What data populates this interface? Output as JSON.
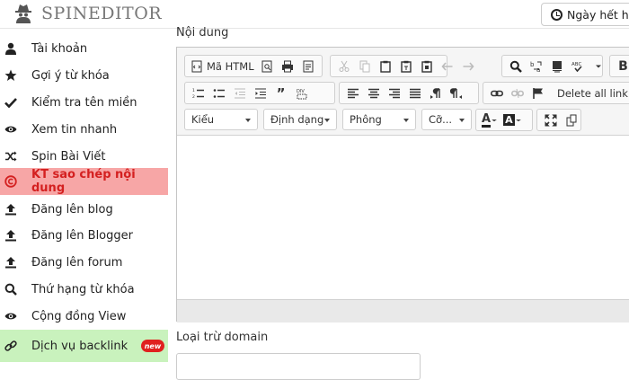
{
  "app": {
    "name": "SPINEDITOR",
    "expiry_button": "Ngày hết hạn"
  },
  "sidebar": {
    "items": [
      {
        "label": "Tài khoản",
        "icon": "user-icon"
      },
      {
        "label": "Gợi ý từ khóa",
        "icon": "star-icon"
      },
      {
        "label": "Kiểm tra tên miền",
        "icon": "check-icon"
      },
      {
        "label": "Xem tin nhanh",
        "icon": "eye-icon"
      },
      {
        "label": "Spin Bài Viết",
        "icon": "shuffle-icon"
      },
      {
        "label": "KT sao chép nội dung",
        "icon": "copyright-icon",
        "active": true
      },
      {
        "label": "Đăng lên blog",
        "icon": "upload-icon"
      },
      {
        "label": "Đăng lên Blogger",
        "icon": "upload-icon"
      },
      {
        "label": "Đăng lên forum",
        "icon": "upload-icon"
      },
      {
        "label": "Thứ hạng từ khóa",
        "icon": "search-icon"
      },
      {
        "label": "Cộng đồng View",
        "icon": "eye-icon"
      },
      {
        "label": "Dịch vụ backlink",
        "icon": "link-icon",
        "badge": "new"
      }
    ],
    "colors": {
      "active_bg": "#f7a6a6",
      "active_text": "#d42020",
      "backlink_bg": "#c9f2bd",
      "badge_bg": "#e0201f"
    }
  },
  "editor": {
    "label": "Nội dung",
    "source_button": "Mã HTML",
    "delete_links_button": "Delete all link",
    "bold_button": "B",
    "combos": {
      "style": "Kiểu",
      "format": "Định dạng",
      "font": "Phông",
      "size": "Cỡ..."
    },
    "text_color_button": "A",
    "bg_color_button": "A"
  },
  "exclude": {
    "label": "Loại trừ domain"
  }
}
